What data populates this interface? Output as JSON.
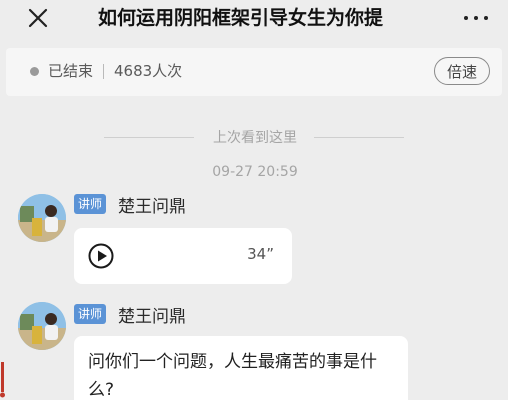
{
  "header": {
    "close_icon": "close-icon",
    "title": "如何运用阴阳框架引导女生为你提",
    "more_icon": "more-dots-icon"
  },
  "status": {
    "state": "已结束",
    "views": "4683人次",
    "speed_label": "倍速"
  },
  "chat": {
    "divider_text": "上次看到这里",
    "timestamp": "09-27 20:59",
    "messages": [
      {
        "role_badge": "讲师",
        "speaker": "楚王问鼎",
        "type": "audio",
        "duration": "34”"
      },
      {
        "role_badge": "讲师",
        "speaker": "楚王问鼎",
        "type": "text",
        "text": "问你们一个问题，人生最痛苦的事是什么?"
      }
    ]
  },
  "colors": {
    "background": "#ededed",
    "badge": "#5b93d6",
    "bubble": "#ffffff",
    "muted_text": "#a5a5a5"
  }
}
